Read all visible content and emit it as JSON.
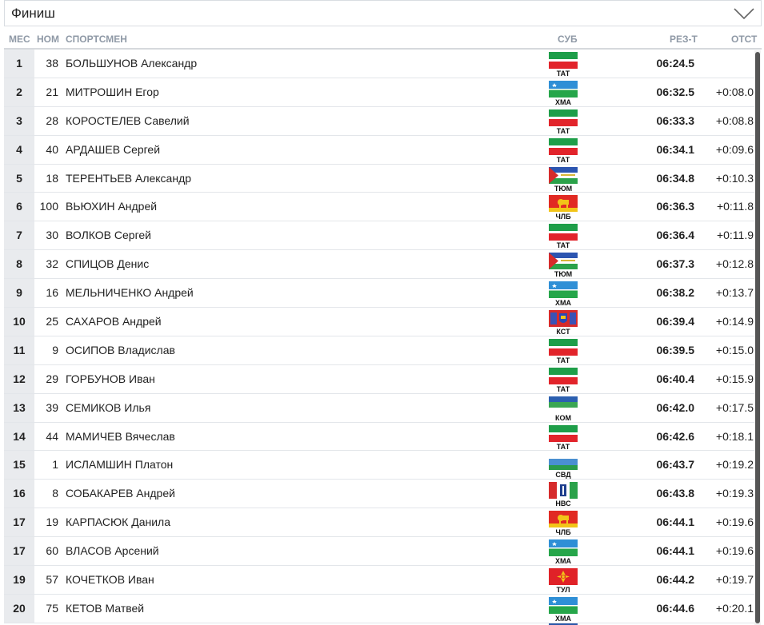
{
  "filter": {
    "selected": "Финиш"
  },
  "columns": {
    "place": "МЕС",
    "bib": "НОМ",
    "name": "СПОРТСМЕН",
    "region": "СУБ",
    "result": "РЕЗ-Т",
    "gap": "ОТСТ"
  },
  "rows": [
    {
      "place": "1",
      "bib": "38",
      "name": "БОЛЬШУНОВ Александр",
      "region": "ТАТ",
      "flag": "tat",
      "result": "06:24.5",
      "gap": ""
    },
    {
      "place": "2",
      "bib": "21",
      "name": "МИТРОШИН Егор",
      "region": "ХМА",
      "flag": "hma",
      "result": "06:32.5",
      "gap": "+0:08.0"
    },
    {
      "place": "3",
      "bib": "28",
      "name": "КОРОСТЕЛЕВ Савелий",
      "region": "ТАТ",
      "flag": "tat",
      "result": "06:33.3",
      "gap": "+0:08.8"
    },
    {
      "place": "4",
      "bib": "40",
      "name": "АРДАШЕВ Сергей",
      "region": "ТАТ",
      "flag": "tat",
      "result": "06:34.1",
      "gap": "+0:09.6"
    },
    {
      "place": "5",
      "bib": "18",
      "name": "ТЕРЕНТЬЕВ Александр",
      "region": "ТЮМ",
      "flag": "tum",
      "result": "06:34.8",
      "gap": "+0:10.3"
    },
    {
      "place": "6",
      "bib": "100",
      "name": "ВЬЮХИН Андрей",
      "region": "ЧЛБ",
      "flag": "chl",
      "result": "06:36.3",
      "gap": "+0:11.8"
    },
    {
      "place": "7",
      "bib": "30",
      "name": "ВОЛКОВ Сергей",
      "region": "ТАТ",
      "flag": "tat",
      "result": "06:36.4",
      "gap": "+0:11.9"
    },
    {
      "place": "8",
      "bib": "32",
      "name": "СПИЦОВ Денис",
      "region": "ТЮМ",
      "flag": "tum",
      "result": "06:37.3",
      "gap": "+0:12.8"
    },
    {
      "place": "9",
      "bib": "16",
      "name": "МЕЛЬНИЧЕНКО Андрей",
      "region": "ХМА",
      "flag": "hma",
      "result": "06:38.2",
      "gap": "+0:13.7"
    },
    {
      "place": "10",
      "bib": "25",
      "name": "САХАРОВ Андрей",
      "region": "КСТ",
      "flag": "kst",
      "result": "06:39.4",
      "gap": "+0:14.9"
    },
    {
      "place": "11",
      "bib": "9",
      "name": "ОСИПОВ Владислав",
      "region": "ТАТ",
      "flag": "tat",
      "result": "06:39.5",
      "gap": "+0:15.0"
    },
    {
      "place": "12",
      "bib": "29",
      "name": "ГОРБУНОВ Иван",
      "region": "ТАТ",
      "flag": "tat",
      "result": "06:40.4",
      "gap": "+0:15.9"
    },
    {
      "place": "13",
      "bib": "39",
      "name": "СЕМИКОВ Илья",
      "region": "КОМ",
      "flag": "kom",
      "result": "06:42.0",
      "gap": "+0:17.5"
    },
    {
      "place": "14",
      "bib": "44",
      "name": "МАМИЧЕВ Вячеслав",
      "region": "ТАТ",
      "flag": "tat",
      "result": "06:42.6",
      "gap": "+0:18.1"
    },
    {
      "place": "15",
      "bib": "1",
      "name": "ИСЛАМШИН Платон",
      "region": "СВД",
      "flag": "svd",
      "result": "06:43.7",
      "gap": "+0:19.2"
    },
    {
      "place": "16",
      "bib": "8",
      "name": "СОБАКАРЕВ Андрей",
      "region": "НВС",
      "flag": "nvs",
      "result": "06:43.8",
      "gap": "+0:19.3"
    },
    {
      "place": "17",
      "bib": "19",
      "name": "КАРПАСЮК Данила",
      "region": "ЧЛБ",
      "flag": "chl",
      "result": "06:44.1",
      "gap": "+0:19.6"
    },
    {
      "place": "17",
      "bib": "60",
      "name": "ВЛАСОВ Арсений",
      "region": "ХМА",
      "flag": "hma",
      "result": "06:44.1",
      "gap": "+0:19.6"
    },
    {
      "place": "19",
      "bib": "57",
      "name": "КОЧЕТКОВ Иван",
      "region": "ТУЛ",
      "flag": "tul",
      "result": "06:44.2",
      "gap": "+0:19.7"
    },
    {
      "place": "20",
      "bib": "75",
      "name": "КЕТОВ Матвей",
      "region": "ХМА",
      "flag": "hma",
      "result": "06:44.6",
      "gap": "+0:20.1"
    }
  ]
}
